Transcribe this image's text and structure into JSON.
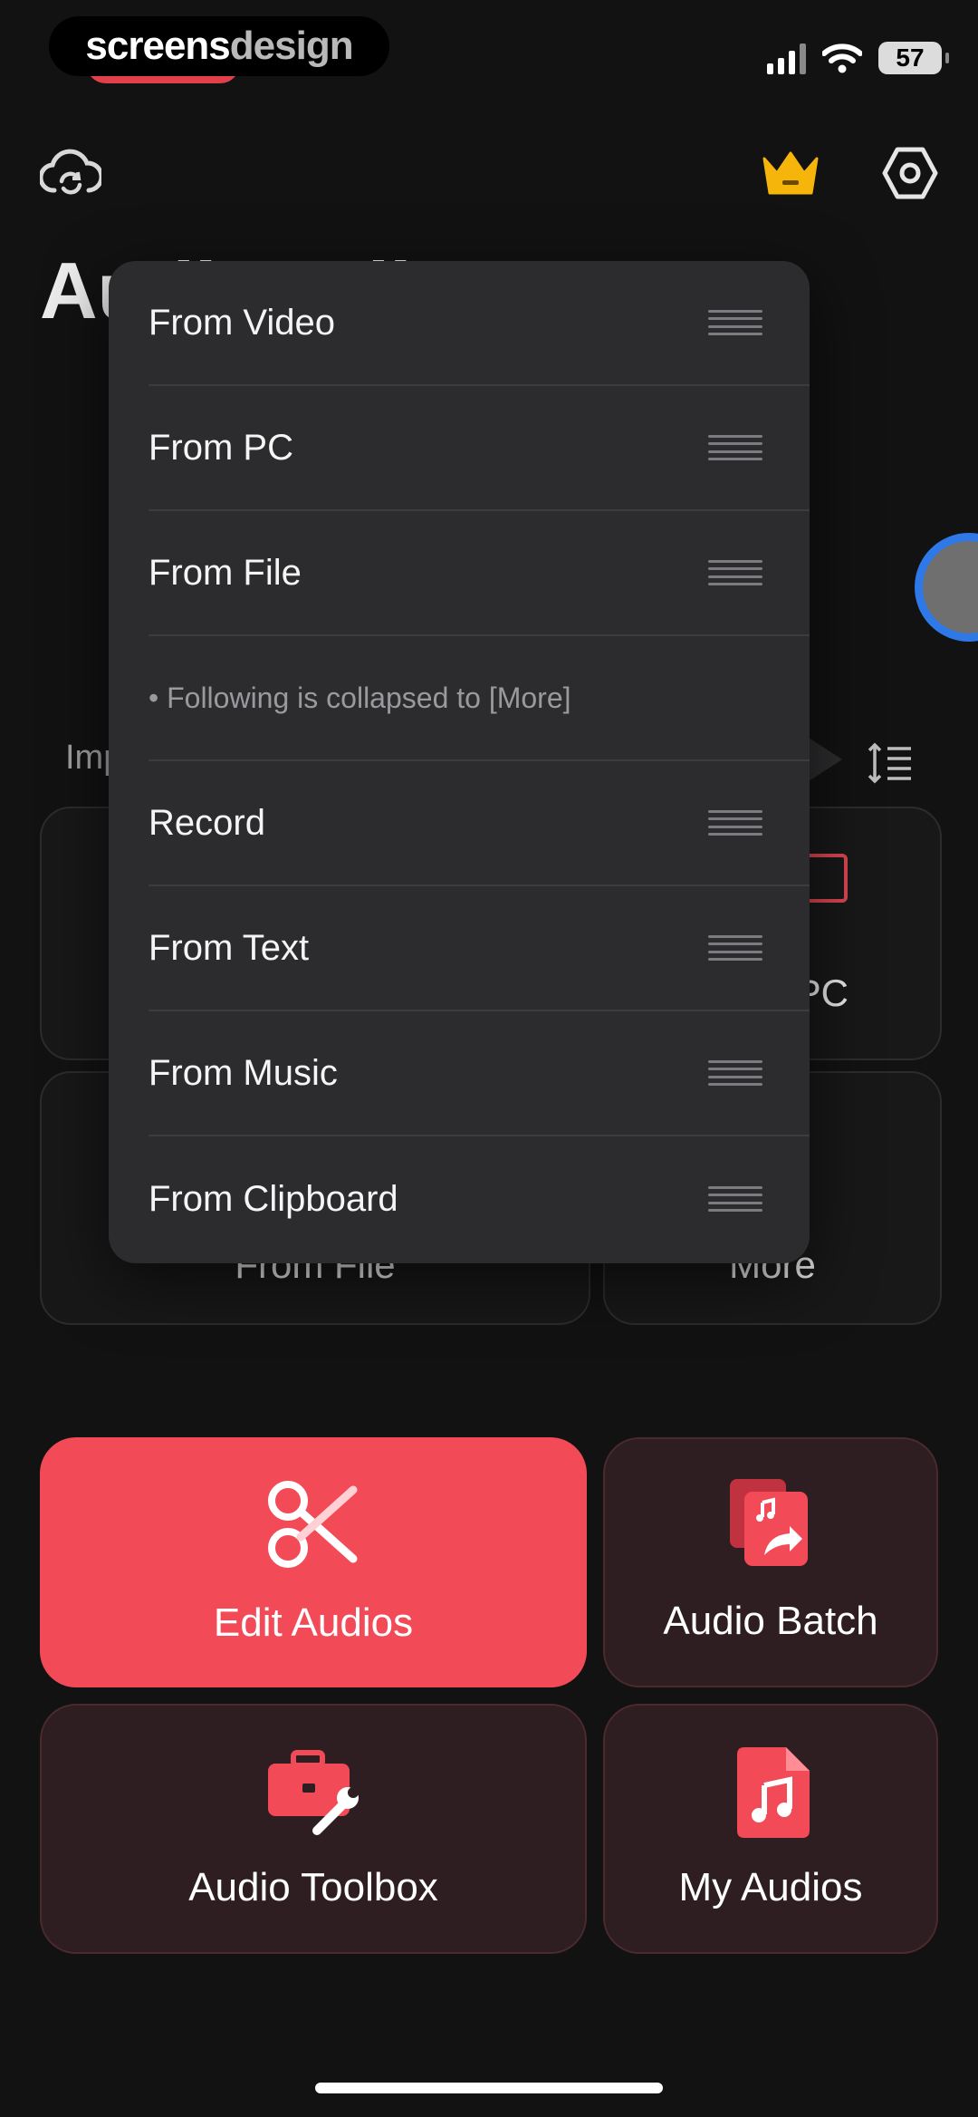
{
  "status_bar": {
    "brand_part1": "screens",
    "brand_part2": "design",
    "battery": "57"
  },
  "background": {
    "title": "Audio Editor",
    "section_label": "Import",
    "cards": [
      "From PC",
      "From File",
      "More"
    ]
  },
  "menu": {
    "items_top": [
      "From Video",
      "From PC",
      "From File"
    ],
    "note": "• Following is collapsed to [More]",
    "items_bottom": [
      "Record",
      "From Text",
      "From Music",
      "From Clipboard"
    ]
  },
  "actions": {
    "edit_audios": "Edit Audios",
    "audio_batch": "Audio Batch",
    "audio_toolbox": "Audio Toolbox",
    "my_audios": "My Audios"
  },
  "colors": {
    "accent_red": "#f24a57",
    "menu_bg": "#2c2c2e",
    "crown": "#f5b50a",
    "avatar_ring": "#2e78e8"
  }
}
